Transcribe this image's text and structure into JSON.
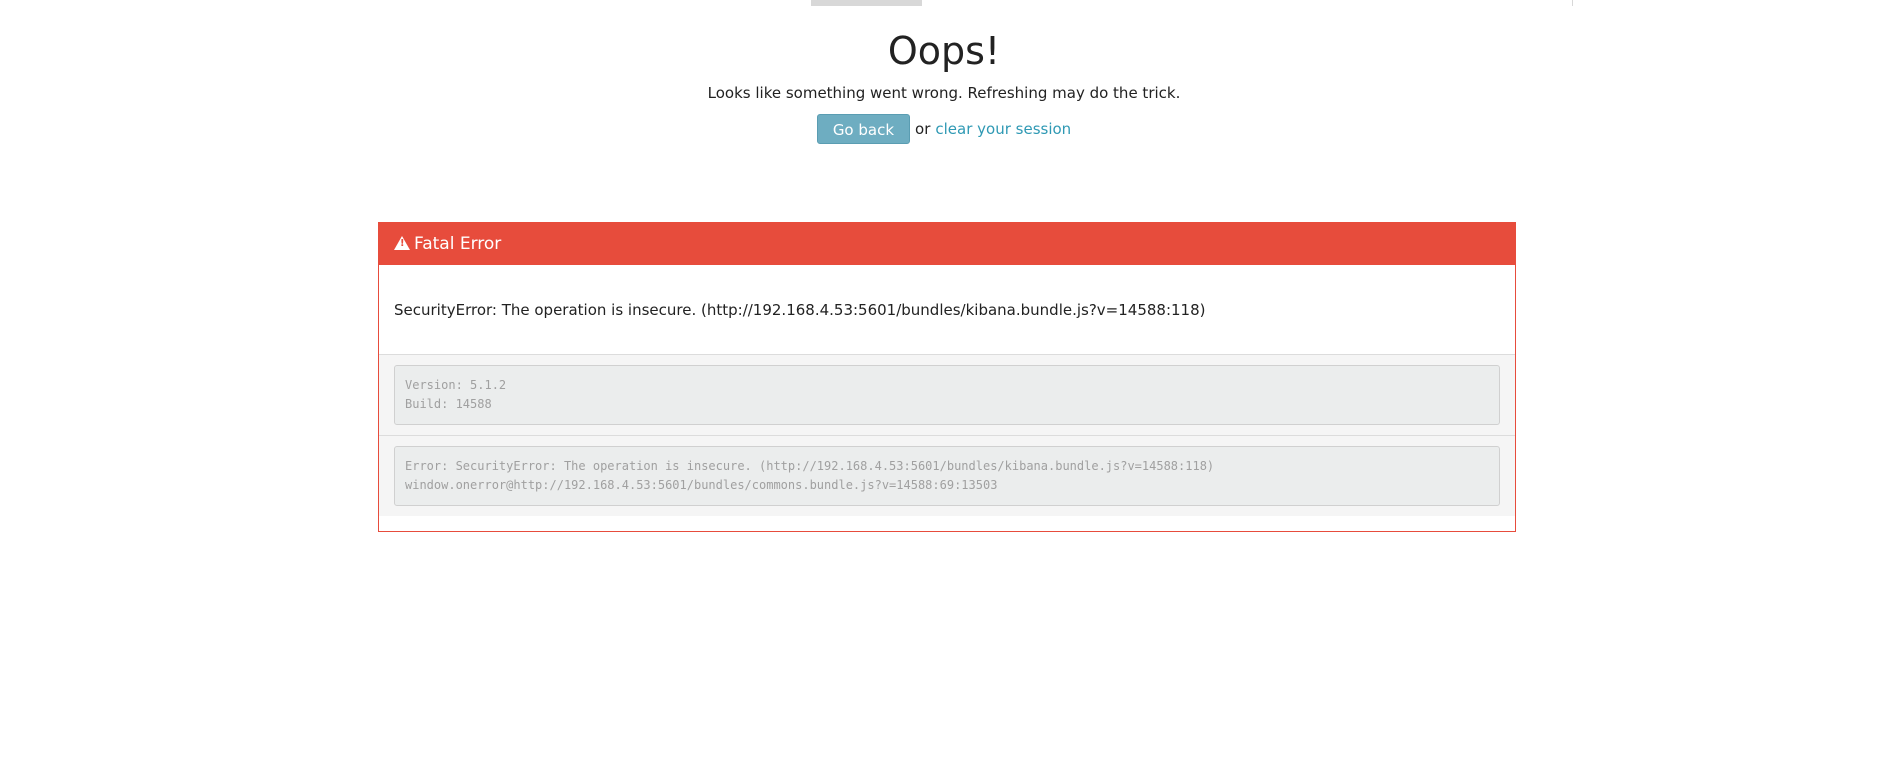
{
  "header": {
    "title": "Oops!",
    "subtitle": "Looks like something went wrong. Refreshing may do the trick.",
    "go_back_label": "Go back",
    "or_text": "or",
    "clear_session_label": "clear your session"
  },
  "error_panel": {
    "icon": "warning-icon",
    "heading": "Fatal Error",
    "message": "SecurityError: The operation is insecure. (http://192.168.4.53:5601/bundles/kibana.bundle.js?v=14588:118)",
    "version_info": {
      "version_line": "Version: 5.1.2",
      "build_line": "Build: 14588"
    },
    "stack": {
      "line1": "Error: SecurityError: The operation is insecure. (http://192.168.4.53:5601/bundles/kibana.bundle.js?v=14588:118)",
      "line2": "window.onerror@http://192.168.4.53:5601/bundles/commons.bundle.js?v=14588:69:13503"
    }
  },
  "colors": {
    "danger": "#e74c3c",
    "button": "#6eadc1",
    "link": "#2f99b4"
  }
}
